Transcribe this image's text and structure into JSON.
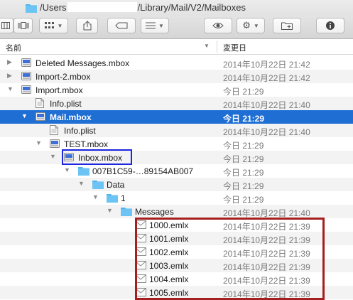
{
  "window": {
    "path_prefix": "/Users",
    "path_suffix": "/Library/Mail/V2/Mailboxes",
    "icon": "folder-icon"
  },
  "toolbar": {
    "view_columns": "columns-view-icon",
    "view_coverflow": "coverflow-view-icon",
    "arrange": "grid-arrange-icon",
    "share": "share-icon",
    "tags": "tag-icon",
    "list_options": "list-icon",
    "quicklook": "eye-icon",
    "action": "gear-icon",
    "new_folder": "new-folder-icon",
    "info": "info-icon"
  },
  "header": {
    "name_label": "名前",
    "date_label": "変更日"
  },
  "rows": [
    {
      "name": "Deleted Messages.mbox",
      "date": "2014年10月22日 21:42",
      "icon": "mailbox-icon",
      "disclosure": "collapsed"
    },
    {
      "name": "Import-2.mbox",
      "date": "2014年10月22日 21:42",
      "icon": "mailbox-icon",
      "disclosure": "collapsed"
    },
    {
      "name": "Import.mbox",
      "date": "今日 21:29",
      "icon": "mailbox-icon",
      "disclosure": "expanded"
    },
    {
      "name": "Info.plist",
      "date": "2014年10月22日 21:40",
      "icon": "file-icon",
      "disclosure": "none"
    },
    {
      "name": "Mail.mbox",
      "date": "今日 21:29",
      "icon": "mailbox-icon",
      "disclosure": "expanded",
      "selected": true
    },
    {
      "name": "Info.plist",
      "date": "2014年10月22日 21:40",
      "icon": "file-icon",
      "disclosure": "none"
    },
    {
      "name": "TEST.mbox",
      "date": "今日 21:29",
      "icon": "mailbox-icon",
      "disclosure": "expanded"
    },
    {
      "name": "Inbox.mbox",
      "date": "今日 21:29",
      "icon": "mailbox-icon",
      "disclosure": "expanded"
    },
    {
      "name": "007B1C59-…89154AB007",
      "date": "今日 21:29",
      "icon": "folder-icon",
      "disclosure": "expanded"
    },
    {
      "name": "Data",
      "date": "今日 21:29",
      "icon": "folder-icon",
      "disclosure": "expanded"
    },
    {
      "name": "1",
      "date": "今日 21:29",
      "icon": "folder-icon",
      "disclosure": "expanded"
    },
    {
      "name": "Messages",
      "date": "2014年10月22日 21:40",
      "icon": "folder-icon",
      "disclosure": "expanded"
    },
    {
      "name": "1000.emlx",
      "date": "2014年10月22日 21:39",
      "icon": "email-file-icon",
      "disclosure": "none"
    },
    {
      "name": "1001.emlx",
      "date": "2014年10月22日 21:39",
      "icon": "email-file-icon",
      "disclosure": "none"
    },
    {
      "name": "1002.emlx",
      "date": "2014年10月22日 21:39",
      "icon": "email-file-icon",
      "disclosure": "none"
    },
    {
      "name": "1003.emlx",
      "date": "2014年10月22日 21:39",
      "icon": "email-file-icon",
      "disclosure": "none"
    },
    {
      "name": "1004.emlx",
      "date": "2014年10月22日 21:39",
      "icon": "email-file-icon",
      "disclosure": "none"
    },
    {
      "name": "1005.emlx",
      "date": "2014年10月22日 21:39",
      "icon": "email-file-icon",
      "disclosure": "none"
    }
  ],
  "colors": {
    "selection": "#1f6ed3",
    "highlight_blue": "#1c25e0",
    "highlight_red": "#a51f1f",
    "folder": "#4fb4f0"
  }
}
